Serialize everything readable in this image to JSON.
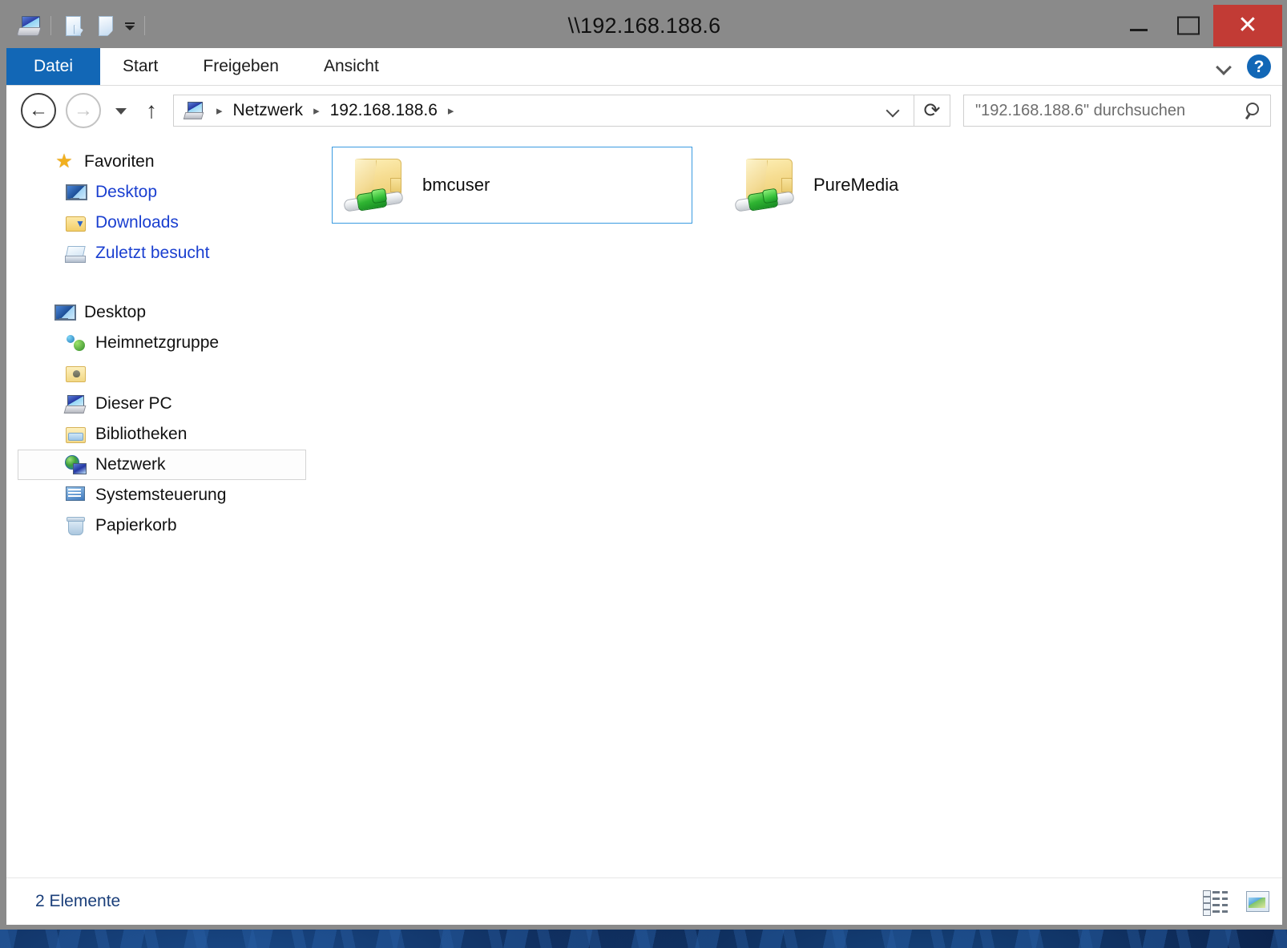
{
  "window": {
    "title": "\\\\192.168.188.6",
    "controls": {
      "minimize": "—",
      "maximize": "□",
      "close": "✕"
    }
  },
  "quick_access": {
    "icons": [
      "network-computer-icon",
      "properties-icon",
      "new-folder-icon",
      "customize-caret-icon"
    ]
  },
  "ribbon": {
    "tabs": [
      {
        "label": "Datei",
        "active": true
      },
      {
        "label": "Start",
        "active": false
      },
      {
        "label": "Freigeben",
        "active": false
      },
      {
        "label": "Ansicht",
        "active": false
      }
    ],
    "expand_icon": "chevron-down-icon",
    "help_label": "?"
  },
  "navbar": {
    "back": "←",
    "forward": "→",
    "recent_caret": "▾",
    "up": "↑",
    "breadcrumb": [
      {
        "label": "Netzwerk"
      },
      {
        "label": "192.168.188.6"
      }
    ],
    "breadcrumb_separator": "▸",
    "refresh": "⟳",
    "dropdown": "chevron-down-icon"
  },
  "search": {
    "placeholder": "\"192.168.188.6\" durchsuchen",
    "value": ""
  },
  "sidebar": {
    "groups": [
      {
        "header": {
          "label": "Favoriten",
          "icon": "star-icon"
        },
        "items": [
          {
            "label": "Desktop",
            "icon": "monitor-icon",
            "link": true
          },
          {
            "label": "Downloads",
            "icon": "downloads-folder-icon",
            "link": true
          },
          {
            "label": "Zuletzt besucht",
            "icon": "recent-places-icon",
            "link": true
          }
        ]
      },
      {
        "header": {
          "label": "Desktop",
          "icon": "monitor-icon"
        },
        "items": [
          {
            "label": "Heimnetzgruppe",
            "icon": "homegroup-icon",
            "link": false
          },
          {
            "label": "",
            "icon": "user-folder-icon",
            "link": false
          },
          {
            "label": "Dieser PC",
            "icon": "this-pc-icon",
            "link": false
          },
          {
            "label": "Bibliotheken",
            "icon": "libraries-icon",
            "link": false
          },
          {
            "label": "Netzwerk",
            "icon": "network-icon",
            "link": false,
            "selected": true
          },
          {
            "label": "Systemsteuerung",
            "icon": "control-panel-icon",
            "link": false
          },
          {
            "label": "Papierkorb",
            "icon": "recycle-bin-icon",
            "link": false
          }
        ]
      }
    ]
  },
  "content": {
    "items": [
      {
        "name": "bmcuser",
        "icon": "shared-folder-icon",
        "selected": true
      },
      {
        "name": "PureMedia",
        "icon": "shared-folder-icon",
        "selected": false
      }
    ]
  },
  "statusbar": {
    "text": "2 Elemente",
    "views": [
      {
        "name": "details-view-button"
      },
      {
        "name": "large-icons-view-button"
      }
    ]
  },
  "colors": {
    "accent_blue": "#1267b6",
    "close_red": "#c23b35",
    "selection_border": "#3a9ae0",
    "link_blue": "#1a3fd0",
    "frame_gray": "#8a8a8a"
  }
}
